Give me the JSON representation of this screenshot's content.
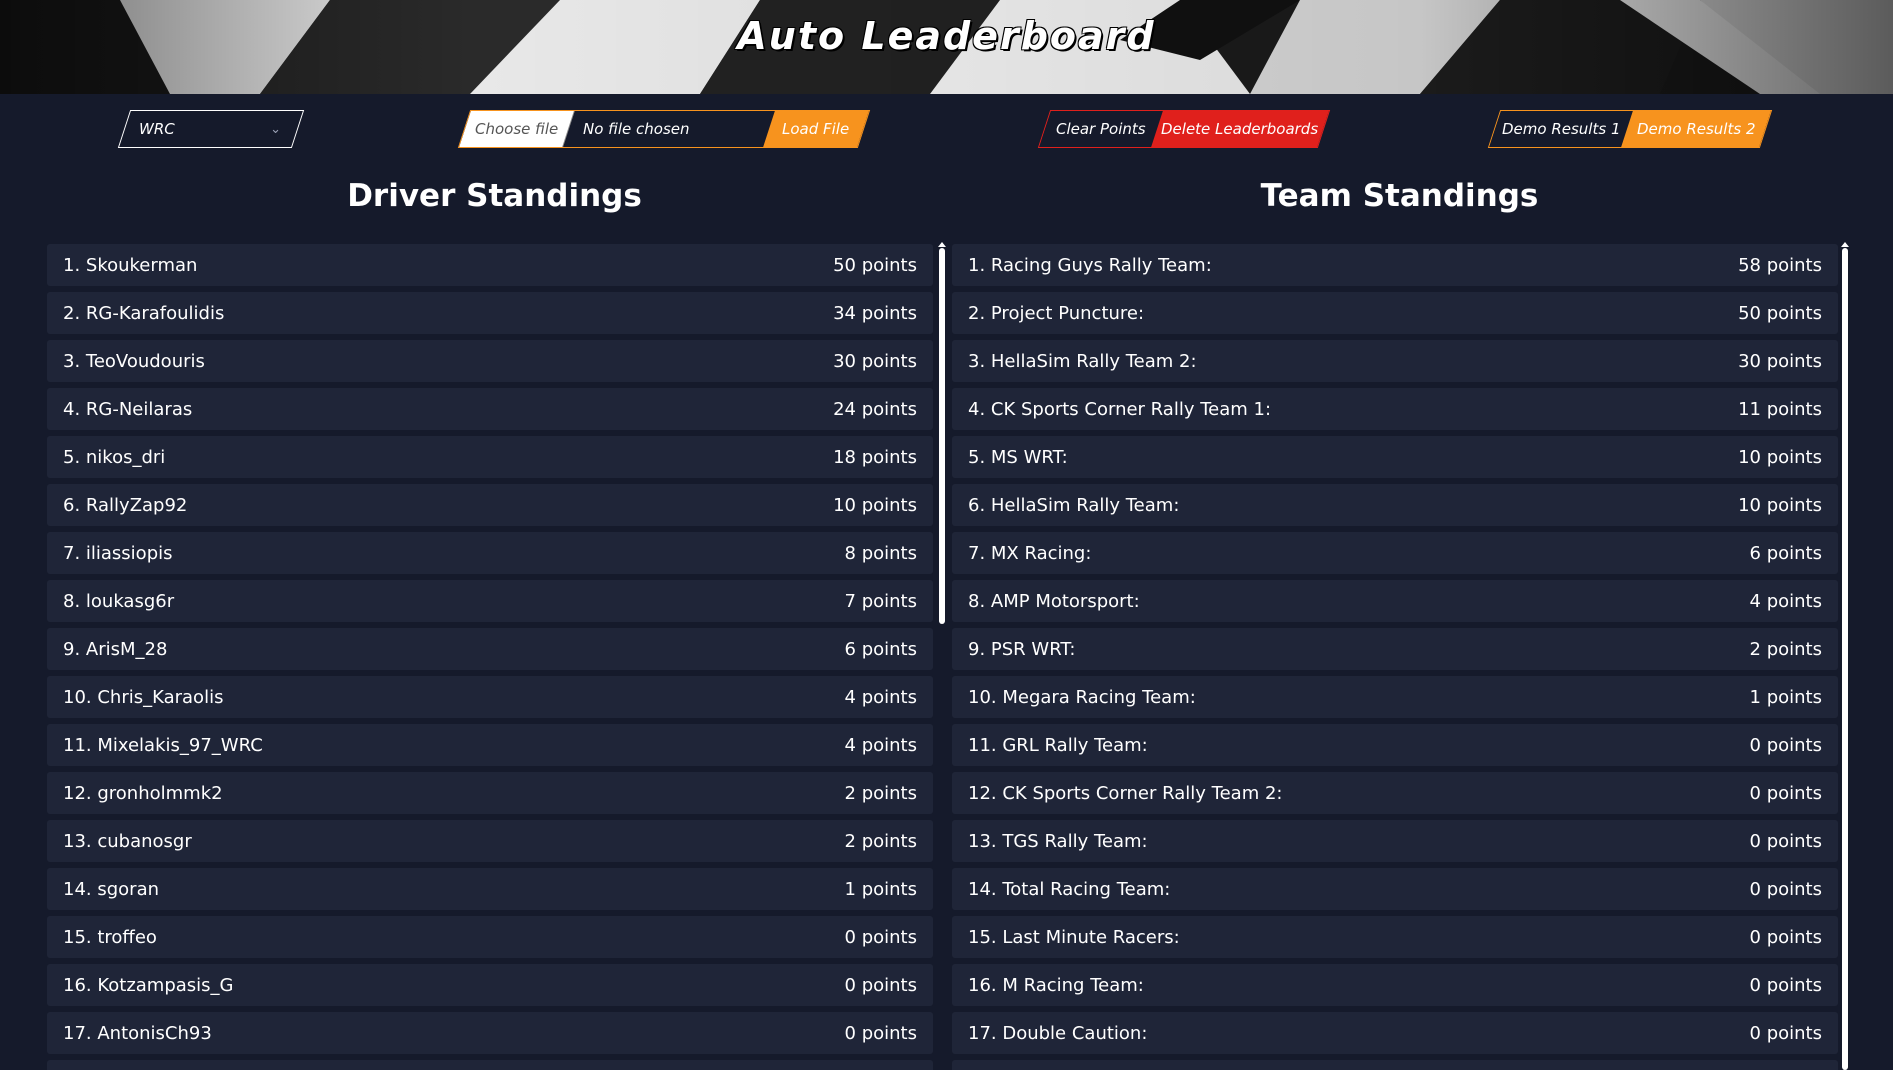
{
  "header": {
    "title": "Auto Leaderboard"
  },
  "controls": {
    "game_select": {
      "value": "WRC"
    },
    "file_upload": {
      "choose_label": "Choose file",
      "file_name": "No file chosen",
      "load_label": "Load File"
    },
    "clear_points_label": "Clear Points",
    "delete_leaderboards_label": "Delete Leaderboards",
    "demo1_label": "Demo Results 1",
    "demo2_label": "Demo Results 2"
  },
  "colors": {
    "accent_orange": "#f7931e",
    "accent_red": "#e0201c",
    "background": "#151a2b",
    "row_background": "#1f2538"
  },
  "driver_standings": {
    "title": "Driver Standings",
    "rows": [
      {
        "name": "1. Skoukerman",
        "points": "50 points"
      },
      {
        "name": "2. RG-Karafoulidis",
        "points": "34 points"
      },
      {
        "name": "3. TeoVoudouris",
        "points": "30 points"
      },
      {
        "name": "4. RG-Neilaras",
        "points": "24 points"
      },
      {
        "name": "5. nikos_dri",
        "points": "18 points"
      },
      {
        "name": "6. RallyZap92",
        "points": "10 points"
      },
      {
        "name": "7. iliassiopis",
        "points": "8 points"
      },
      {
        "name": "8. loukasg6r",
        "points": "7 points"
      },
      {
        "name": "9. ArisM_28",
        "points": "6 points"
      },
      {
        "name": "10. Chris_Karaolis",
        "points": "4 points"
      },
      {
        "name": "11. Mixelakis_97_WRC",
        "points": "4 points"
      },
      {
        "name": "12. gronholmmk2",
        "points": "2 points"
      },
      {
        "name": "13. cubanosgr",
        "points": "2 points"
      },
      {
        "name": "14. sgoran",
        "points": "1 points"
      },
      {
        "name": "15. troffeo",
        "points": "0 points"
      },
      {
        "name": "16. Kotzampasis_G",
        "points": "0 points"
      },
      {
        "name": "17. AntonisCh93",
        "points": "0 points"
      }
    ]
  },
  "team_standings": {
    "title": "Team Standings",
    "rows": [
      {
        "name": "1. Racing Guys Rally Team:",
        "points": "58 points"
      },
      {
        "name": "2. Project Puncture:",
        "points": "50 points"
      },
      {
        "name": "3. HellaSim Rally Team 2:",
        "points": "30 points"
      },
      {
        "name": "4. CK Sports Corner Rally Team 1:",
        "points": "11 points"
      },
      {
        "name": "5. MS WRT:",
        "points": "10 points"
      },
      {
        "name": "6. HellaSim Rally Team:",
        "points": "10 points"
      },
      {
        "name": "7. MX Racing:",
        "points": "6 points"
      },
      {
        "name": "8. AMP Motorsport:",
        "points": "4 points"
      },
      {
        "name": "9. PSR WRT:",
        "points": "2 points"
      },
      {
        "name": "10. Megara Racing Team:",
        "points": "1 points"
      },
      {
        "name": "11. GRL Rally Team:",
        "points": "0 points"
      },
      {
        "name": "12. CK Sports Corner Rally Team 2:",
        "points": "0 points"
      },
      {
        "name": "13. TGS Rally Team:",
        "points": "0 points"
      },
      {
        "name": "14. Total Racing Team:",
        "points": "0 points"
      },
      {
        "name": "15. Last Minute Racers:",
        "points": "0 points"
      },
      {
        "name": "16. M Racing Team:",
        "points": "0 points"
      },
      {
        "name": "17. Double Caution:",
        "points": "0 points"
      }
    ]
  }
}
